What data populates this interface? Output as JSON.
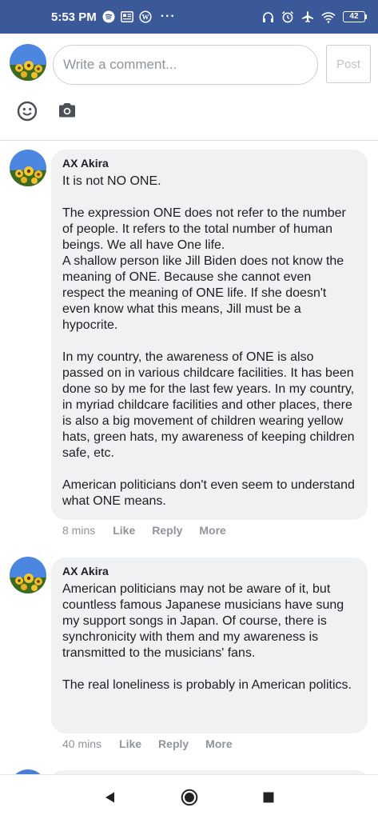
{
  "status_bar": {
    "time": "5:53 PM",
    "battery": "42",
    "dots": "···"
  },
  "composer": {
    "placeholder": "Write a comment...",
    "post_label": "Post"
  },
  "comments": [
    {
      "author": "AX Akira",
      "text": "It is not NO ONE.\n\nThe expression ONE does not refer to the number of people. It refers to the total number of human beings. We all have One life.\nA shallow person like Jill Biden does not know the meaning of ONE. Because she cannot even respect the meaning of ONE life. If she doesn't even know what this means, Jill must be a hypocrite.\n\nIn my country, the awareness of ONE is also passed on in various childcare facilities. It has been done so by me for the last few years. In my country, in myriad childcare facilities and other places, there is also a big movement of children wearing yellow hats, green hats, my awareness of keeping children safe, etc.\n\nAmerican politicians don't even seem to understand what ONE means.",
      "time": "8 mins",
      "like_label": "Like",
      "reply_label": "Reply",
      "more_label": "More"
    },
    {
      "author": "AX Akira",
      "text": "American politicians may not be aware of it, but countless famous Japanese musicians have sung my support songs in Japan. Of course, there is synchronicity with them and my awareness is transmitted to the musicians' fans.\n\nThe real loneliness is probably in American politics.",
      "time": "40 mins",
      "like_label": "Like",
      "reply_label": "Reply",
      "more_label": "More"
    }
  ],
  "colors": {
    "status_bar": "#3b5998",
    "bubble": "#f0f1f3",
    "meta_text": "#90949c"
  },
  "icons": {
    "emoji": "emoji-icon",
    "camera": "camera-icon",
    "back": "back-icon",
    "home": "home-icon",
    "recents": "recents-icon"
  }
}
